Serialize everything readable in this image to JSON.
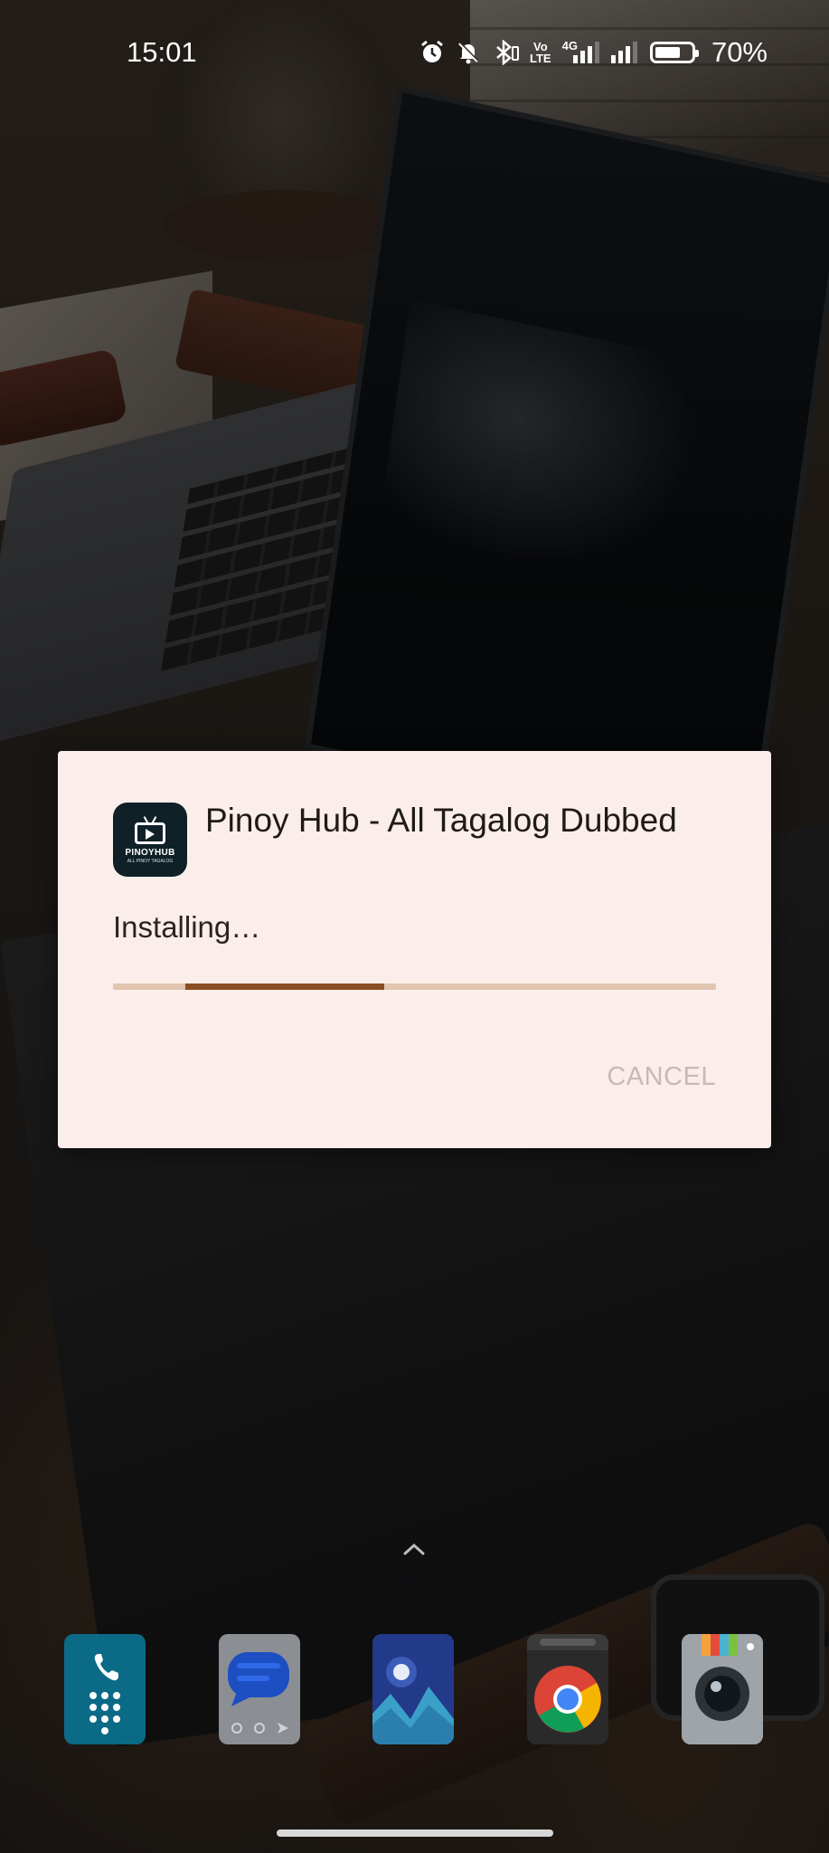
{
  "status_bar": {
    "time": "15:01",
    "icons": [
      "alarm-icon",
      "mute-icon",
      "bluetooth-icon",
      "volte-icon",
      "signal-4g-icon",
      "signal-icon",
      "battery-icon"
    ],
    "volte_text": "VoD LTE2",
    "network_type": "4G",
    "battery_percent": "70%",
    "battery_level": 0.7
  },
  "dialog": {
    "app_name": "Pinoy Hub - All Tagalog Dubbed",
    "app_icon": {
      "label": "PINOYHUB",
      "sublabel": "ALL PINOY TAGALOG"
    },
    "status": "Installing…",
    "progress": {
      "indeterminate": true,
      "segment_start": 0.12,
      "segment_end": 0.45
    },
    "cancel_label": "CANCEL",
    "colors": {
      "background": "#fbeeea",
      "track": "#e0c5b0",
      "progress": "#8c4e23",
      "cancel_disabled": "#c6bab5"
    }
  },
  "home": {
    "dock_apps": [
      {
        "name": "Phone",
        "icon": "phone-icon"
      },
      {
        "name": "Messages",
        "icon": "messages-icon"
      },
      {
        "name": "Gallery",
        "icon": "gallery-icon"
      },
      {
        "name": "Chrome",
        "icon": "chrome-icon"
      },
      {
        "name": "Camera",
        "icon": "camera-icon"
      }
    ]
  }
}
